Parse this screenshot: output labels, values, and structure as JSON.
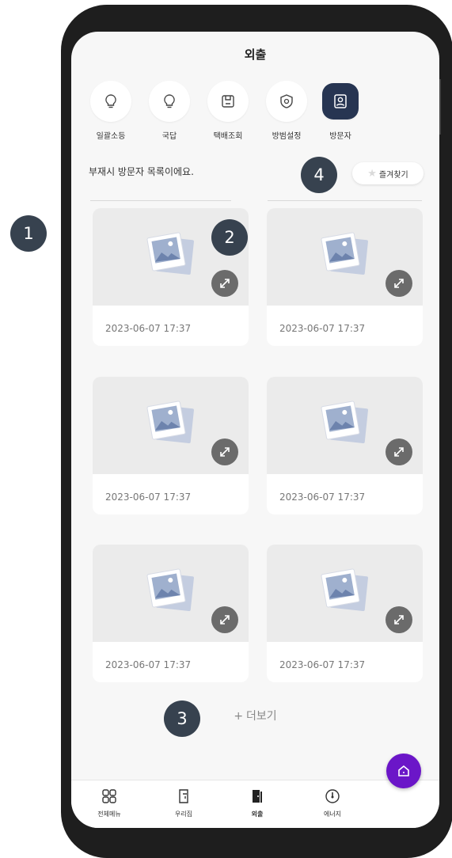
{
  "header": {
    "title": "외출"
  },
  "quick_actions": [
    {
      "label": "일괄소등",
      "icon": "bulb-icon"
    },
    {
      "label": "국답",
      "icon": "bulb-icon"
    },
    {
      "label": "택배조회",
      "icon": "parcel-box-icon"
    },
    {
      "label": "방범설정",
      "icon": "shield-icon"
    },
    {
      "label": "방문자",
      "icon": "visitor-icon",
      "active": true
    }
  ],
  "visitors": {
    "subtitle": "부재시 방문자 목록이에요.",
    "favorite_label": "즐겨찾기",
    "cards": [
      {
        "time": "2023-06-07 17:37"
      },
      {
        "time": "2023-06-07 17:37"
      },
      {
        "time": "2023-06-07 17:37"
      },
      {
        "time": "2023-06-07 17:37"
      },
      {
        "time": "2023-06-07 17:37"
      },
      {
        "time": "2023-06-07 17:37"
      }
    ],
    "more_label": "더보기"
  },
  "bottom_nav": [
    {
      "label": "전체메뉴",
      "icon": "grid-icon"
    },
    {
      "label": "우리집",
      "icon": "door-icon"
    },
    {
      "label": "외출",
      "icon": "exit-door-icon",
      "active": true
    },
    {
      "label": "에너지",
      "icon": "gauge-icon"
    }
  ],
  "markers": [
    "1",
    "2",
    "3",
    "4"
  ],
  "colors": {
    "accent_navy": "#273552",
    "fab_purple": "#6b16c8",
    "marker": "#37424f"
  }
}
